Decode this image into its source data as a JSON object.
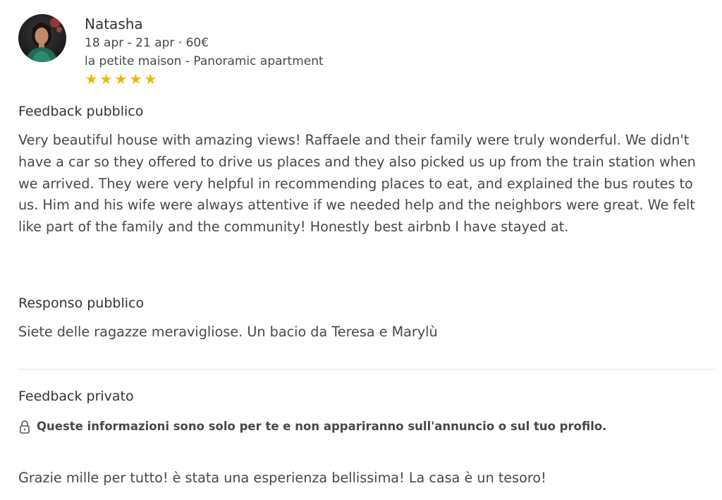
{
  "review": {
    "guest_name": "Natasha",
    "dates_price": "18 apr - 21 apr · 60€",
    "listing": "la petite maison - Panoramic apartment",
    "rating_stars": 5,
    "star_color": "#f4b400"
  },
  "public_feedback": {
    "title": "Feedback pubblico",
    "text": "Very beautiful house with amazing views! Raffaele and their family were truly wonderful. We didn't have a car so they offered to drive us places and they also picked us up from the train station when we arrived. They were very helpful in recommending places to eat, and explained the bus routes to us. Him and his wife were always attentive if we needed help and the neighbors were great. We felt like part of the family and the community! Honestly best airbnb I have stayed at."
  },
  "public_response": {
    "title": "Responso pubblico",
    "text": "Siete delle ragazze meravigliose. Un bacio da Teresa e Marylù"
  },
  "private_feedback": {
    "title": "Feedback privato",
    "notice": "Queste informazioni sono solo per te e non appariranno sull'annuncio o sul tuo profilo.",
    "notice_icon": "lock-icon",
    "text": "Grazie mille per tutto! è stata una esperienza bellissima! La casa è un tesoro!"
  }
}
